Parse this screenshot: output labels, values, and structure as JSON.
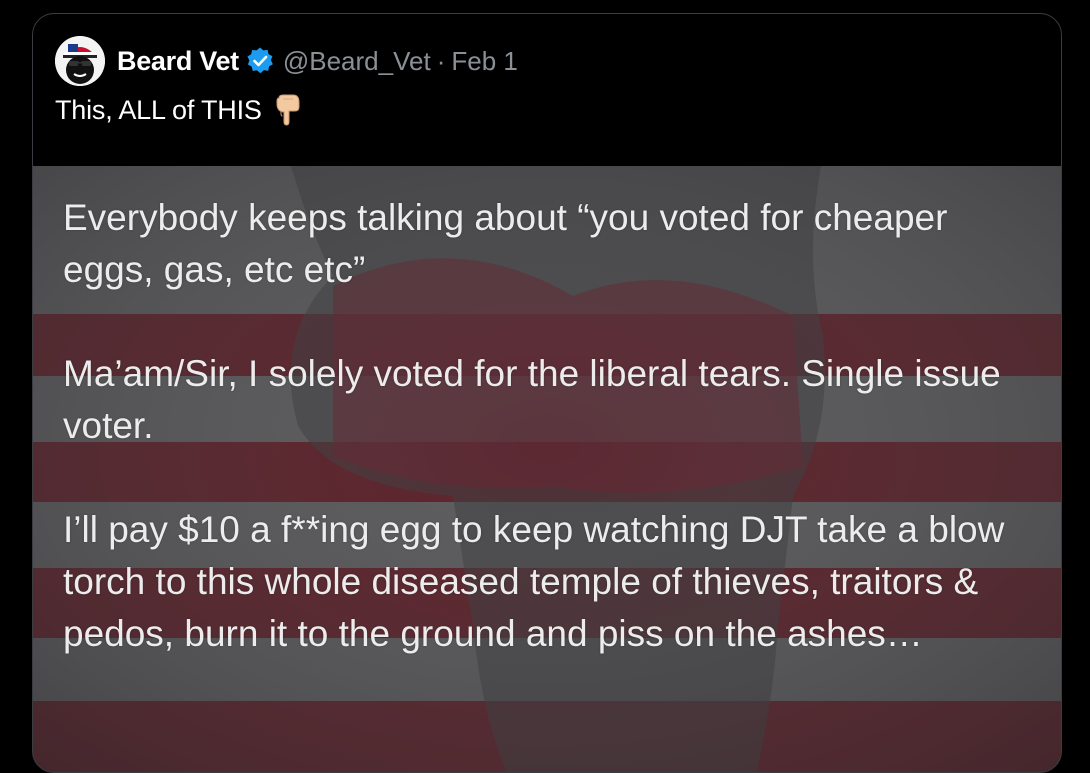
{
  "tweet": {
    "display_name": "Beard Vet",
    "handle": "@Beard_Vet",
    "separator": "·",
    "date": "Feb 1",
    "text": "This, ALL of THIS",
    "emoji": "backhand-index-pointing-down-icon",
    "verified_color": "#1d9bf0"
  },
  "media": {
    "paragraphs": [
      "Everybody keeps talking about “you voted for cheaper eggs, gas, etc etc”",
      "Ma’am/Sir, I solely voted for the liberal tears. Single issue voter.",
      "I’ll pay $10 a f**ing egg to keep watching DJT take a blow torch to this whole diseased temple of thieves, traitors & pedos, burn it to the ground and piss on the ashes…"
    ],
    "stripe_color": "#5e1a24",
    "gray_color": "#5d5d5f"
  }
}
